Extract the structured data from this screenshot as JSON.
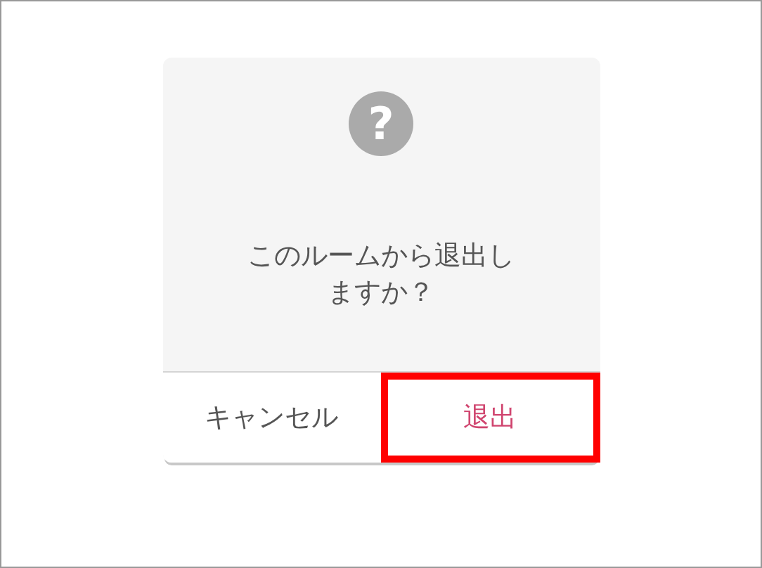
{
  "dialog": {
    "icon": "?",
    "message": "このルームから退出しますか？",
    "buttons": [
      {
        "label": "キャンセル",
        "kind": "cancel",
        "highlighted": false
      },
      {
        "label": "退出",
        "kind": "destructive",
        "highlighted": true
      }
    ]
  }
}
